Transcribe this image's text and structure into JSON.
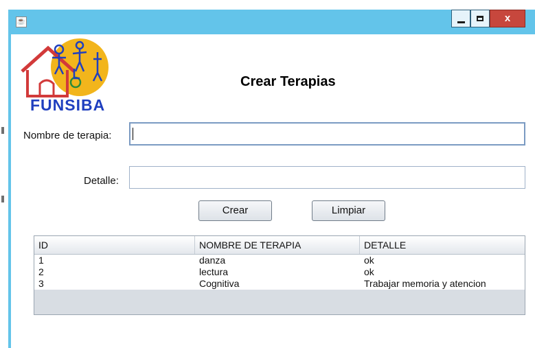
{
  "window": {
    "controls": {
      "minimize_icon": "minimize-icon",
      "maximize_icon": "maximize-icon",
      "close_label": "x"
    }
  },
  "logo": {
    "text": "FUNSIBA",
    "colors": {
      "sun": "#f2b51c",
      "house": "#d23a3a",
      "text": "#1f3fbf"
    }
  },
  "form": {
    "title": "Crear Terapias",
    "nombre_label": "Nombre de terapia:",
    "nombre_value": "",
    "detalle_label": "Detalle:",
    "detalle_value": ""
  },
  "buttons": {
    "crear": "Crear",
    "limpiar": "Limpiar"
  },
  "table": {
    "headers": [
      "ID",
      "NOMBRE DE TERAPIA",
      "DETALLE"
    ],
    "rows": [
      [
        "1",
        "danza",
        "ok"
      ],
      [
        "2",
        "lectura",
        "ok"
      ],
      [
        "3",
        "Cognitiva",
        "Trabajar memoria y atencion"
      ]
    ]
  }
}
